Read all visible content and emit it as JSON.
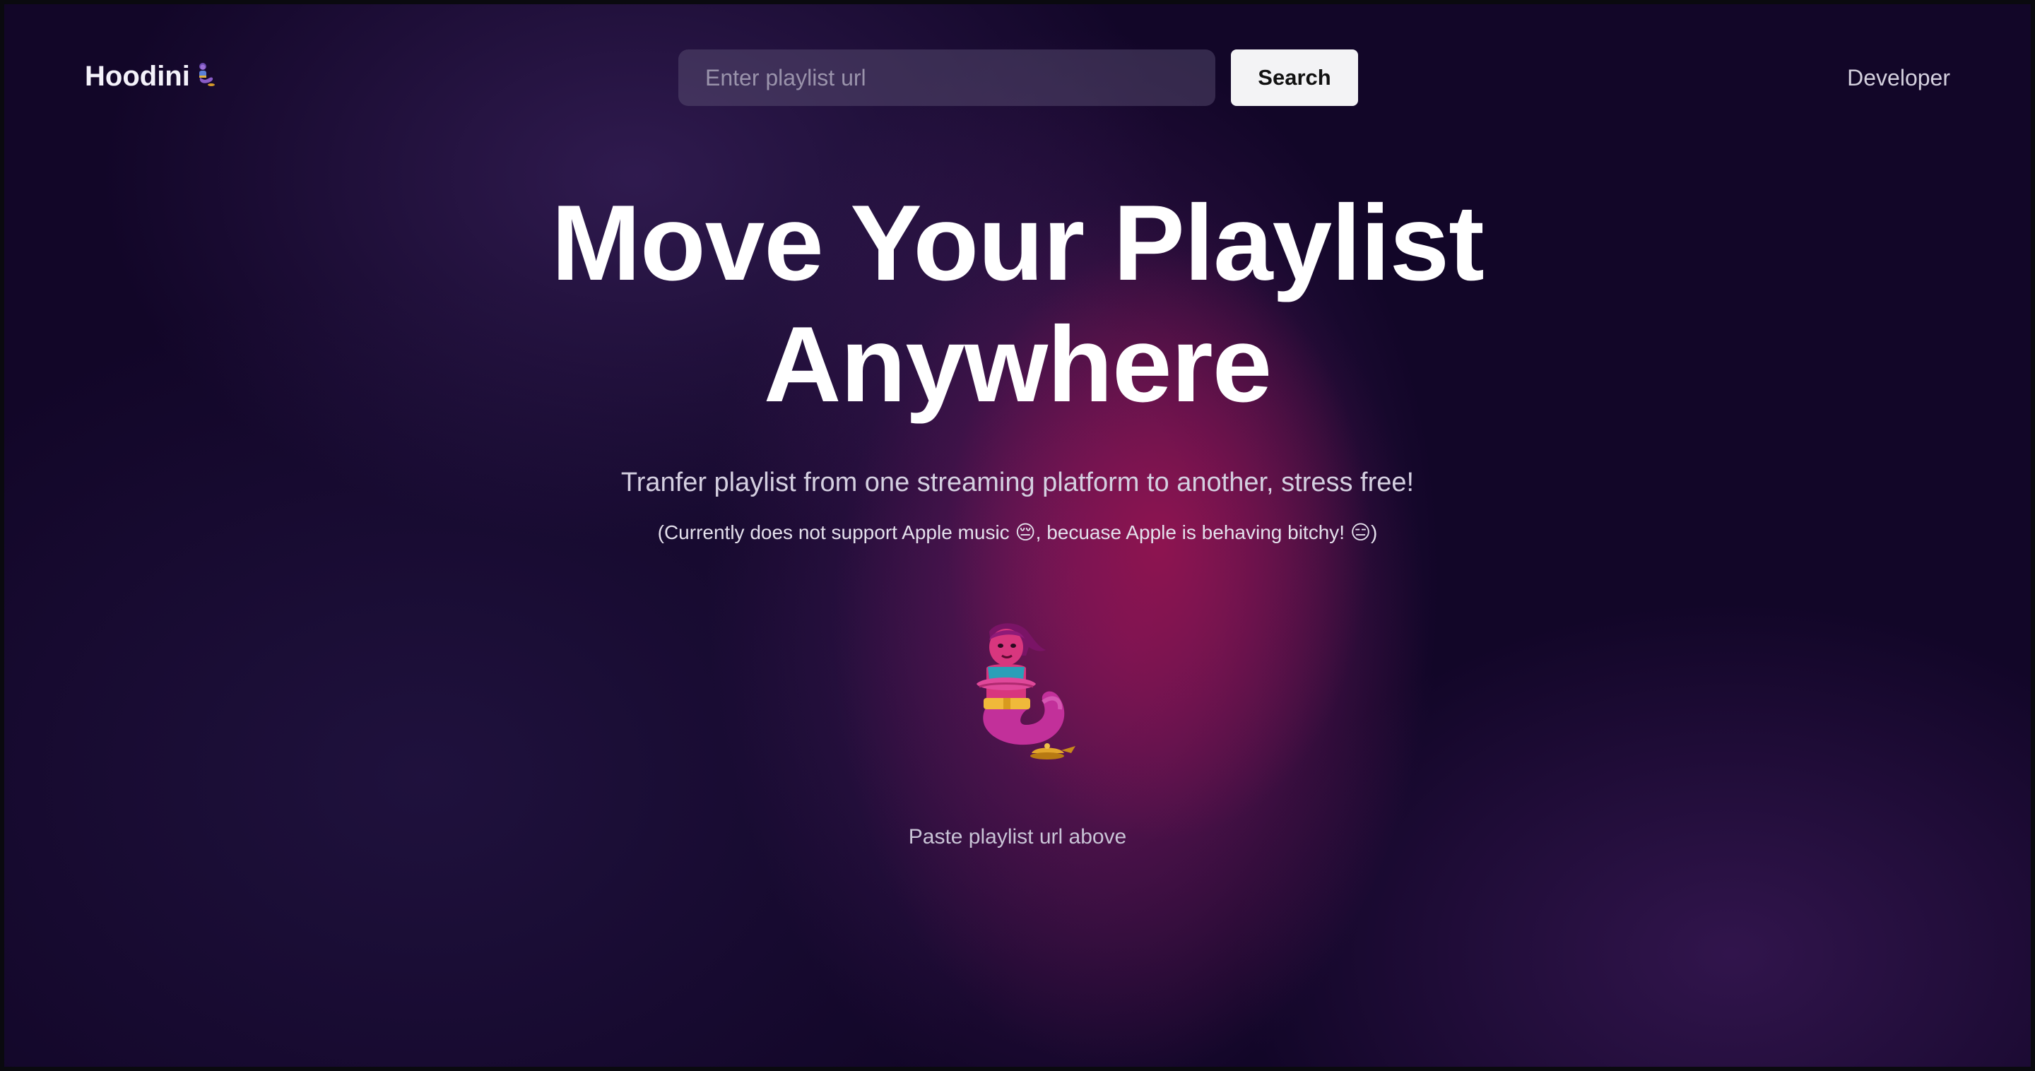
{
  "header": {
    "logo_text": "Hoodini",
    "logo_icon": "genie-icon",
    "developer_link": "Developer"
  },
  "search": {
    "placeholder": "Enter playlist url",
    "value": "",
    "button_label": "Search"
  },
  "hero": {
    "title_line1": "Move Your Playlist",
    "title_line2": "Anywhere",
    "subtitle": "Tranfer playlist from one streaming platform to another, stress free!",
    "note": "(Currently does not support Apple music 😔, becuase Apple is behaving bitchy! 😑)"
  },
  "illustration": {
    "icon": "genie-icon"
  },
  "status": {
    "message": "Paste playlist url above"
  },
  "colors": {
    "background": "#14082a",
    "accent_glow": "#96144f",
    "button_bg": "#f3f3f5",
    "input_bg": "#3d3550"
  }
}
